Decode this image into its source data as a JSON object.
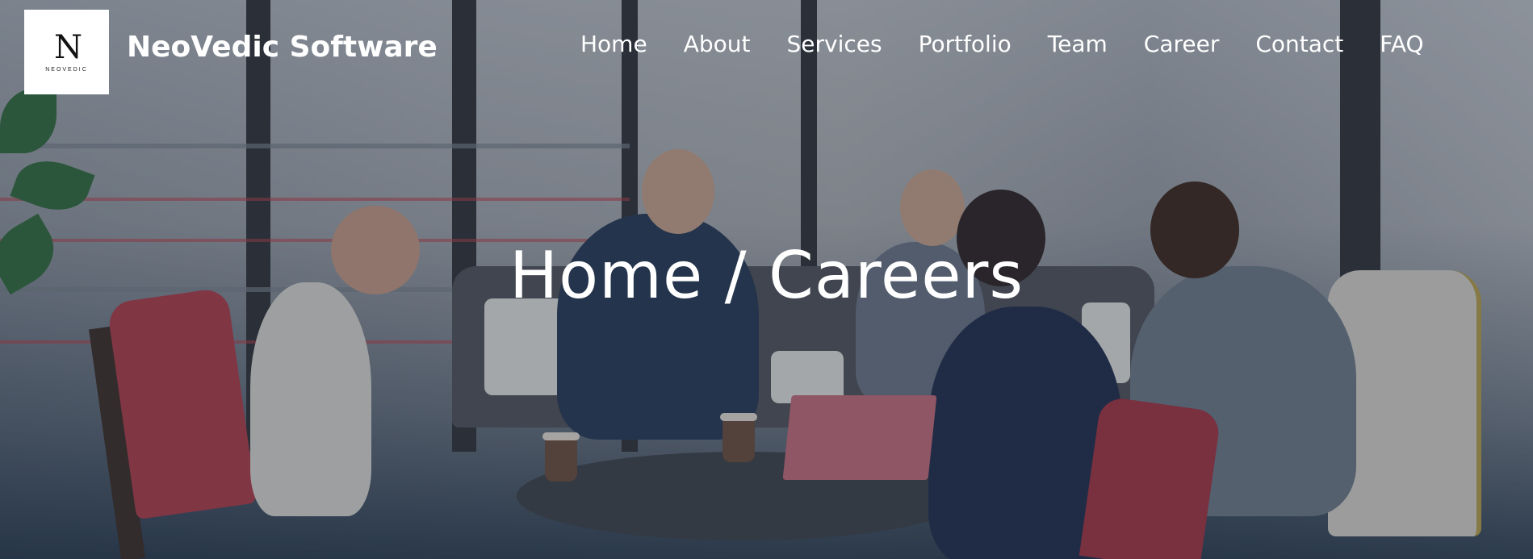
{
  "brand": {
    "logo_mark": "N",
    "logo_sub": "NEOVEDIC",
    "name": "NeoVedic Software"
  },
  "nav": {
    "items": [
      {
        "label": "Home"
      },
      {
        "label": "About"
      },
      {
        "label": "Services"
      },
      {
        "label": "Portfolio"
      },
      {
        "label": "Team"
      },
      {
        "label": "Career"
      },
      {
        "label": "Contact"
      },
      {
        "label": "FAQ"
      }
    ]
  },
  "hero": {
    "heading": "Home / Careers"
  },
  "colors": {
    "nav_text": "#ffffff",
    "logo_bg": "#ffffff",
    "overlay": "#1c2a3a"
  }
}
